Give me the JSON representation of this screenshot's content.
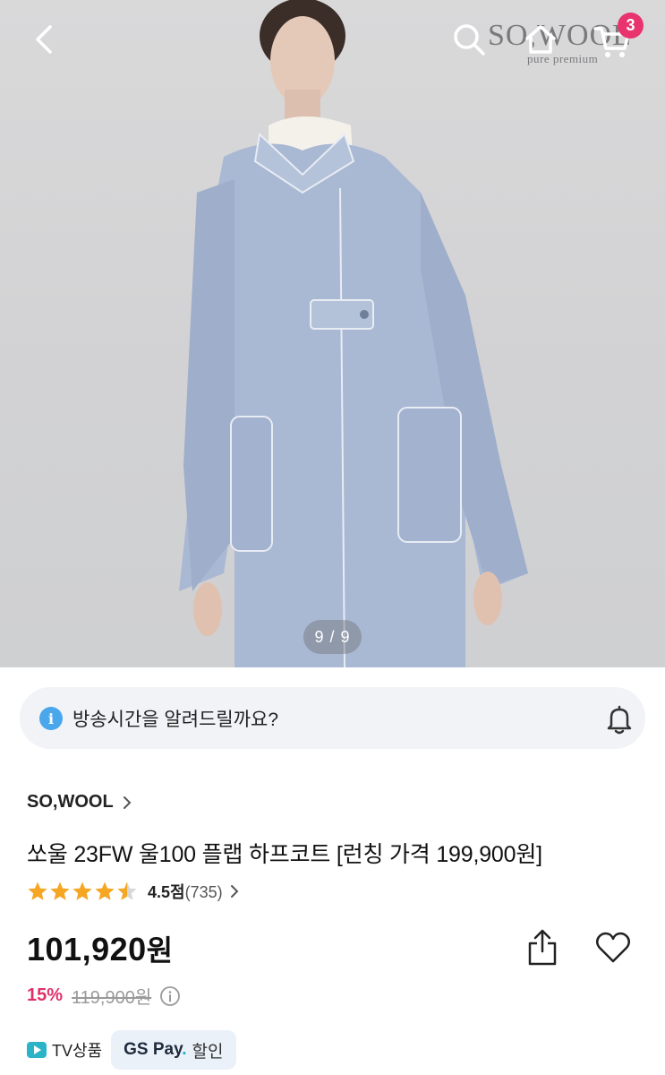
{
  "header": {
    "brand_watermark": "SO,WOOL",
    "brand_watermark_sub": "pure premium",
    "cart_count": "3"
  },
  "gallery": {
    "pager": "9 / 9"
  },
  "notice": {
    "text": "방송시간을 알려드릴까요?"
  },
  "product": {
    "brand": "SO,WOOL",
    "title": "쏘울 23FW 울100 플랩 하프코트 [런칭 가격 199,900원]",
    "rating": {
      "score": "4.5점",
      "count": "(735)",
      "stars": 4.5
    },
    "price": "101,920",
    "price_unit": "원",
    "discount_rate": "15%",
    "original_price": "119,900원"
  },
  "tags": {
    "tv": "TV상품",
    "gspay_brand": "GS Pay",
    "gspay_brand_dot": ".",
    "gspay_label": "할인"
  },
  "colors": {
    "accent_pink": "#e8336e",
    "discount": "#e0306a",
    "info_blue": "#4aa7ec",
    "coat": "#a9b8d3"
  },
  "icons": [
    "back-icon",
    "search-icon",
    "home-icon",
    "cart-icon",
    "info-icon",
    "bell-icon",
    "chevron-right-icon",
    "star-icon",
    "share-icon",
    "heart-icon",
    "info-circle-icon",
    "tv-icon"
  ]
}
